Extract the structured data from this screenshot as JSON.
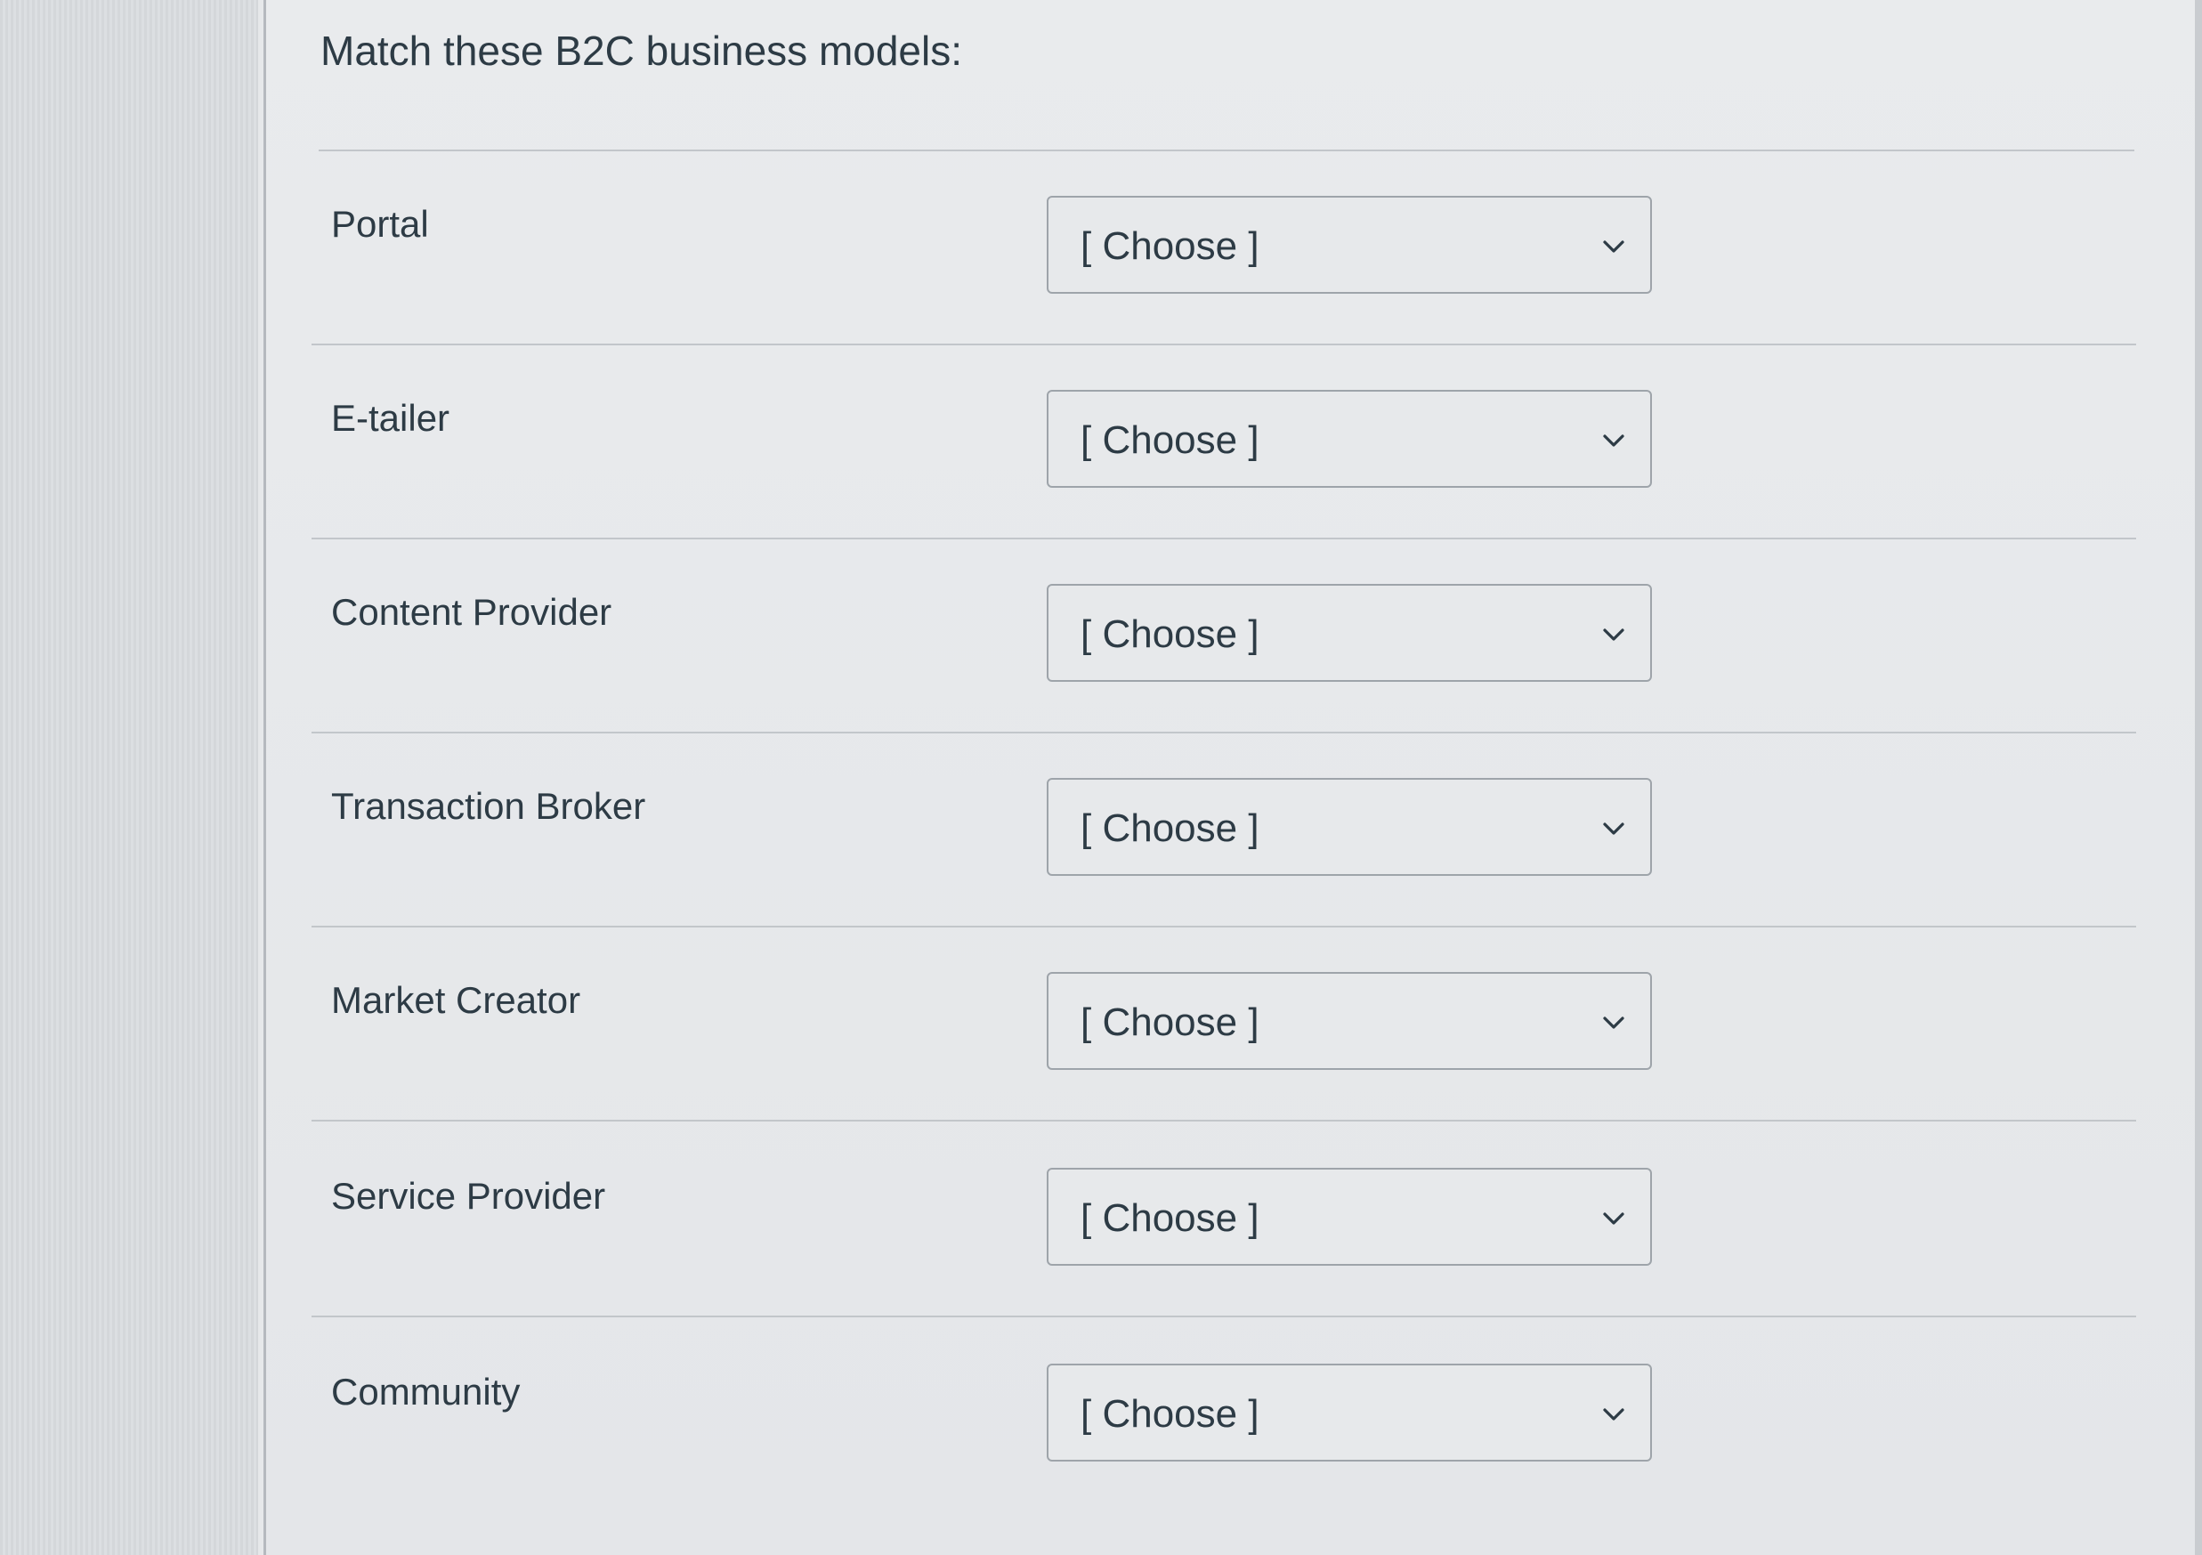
{
  "question": {
    "title": "Match these B2C business models:"
  },
  "rows": [
    {
      "label": "Portal",
      "selected": "[ Choose ]"
    },
    {
      "label": "E-tailer",
      "selected": "[ Choose ]"
    },
    {
      "label": "Content Provider",
      "selected": "[ Choose ]"
    },
    {
      "label": "Transaction Broker",
      "selected": "[ Choose ]"
    },
    {
      "label": "Market Creator",
      "selected": "[ Choose ]"
    },
    {
      "label": "Service Provider",
      "selected": "[ Choose ]"
    },
    {
      "label": "Community",
      "selected": "[ Choose ]"
    }
  ],
  "icons": {
    "dropdown": "chevron-down-icon"
  },
  "colors": {
    "text": "#2d3b45",
    "border": "#9ea4aa",
    "rule": "#c2c6ca",
    "panel": "#e7e9eb"
  }
}
